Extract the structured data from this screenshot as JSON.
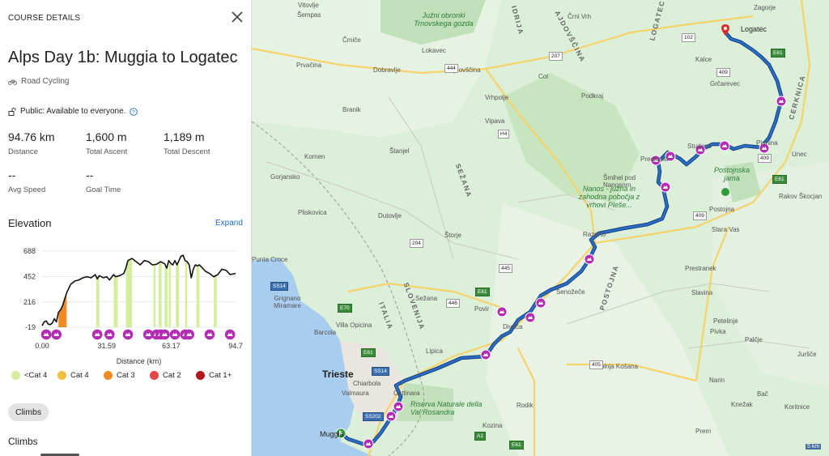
{
  "panel": {
    "header": "COURSE DETAILS",
    "title": "Alps Day 1b: Muggia to Logatec",
    "sport": "Road Cycling",
    "visibility": "Public: Available to everyone.",
    "stats": [
      {
        "value": "94.76 km",
        "label": "Distance"
      },
      {
        "value": "1,600 m",
        "label": "Total Ascent"
      },
      {
        "value": "1,189 m",
        "label": "Total Descent"
      },
      {
        "value": "--",
        "label": "Avg Speed"
      },
      {
        "value": "--",
        "label": "Goal Time"
      }
    ],
    "elevation_heading": "Elevation",
    "expand_label": "Expand",
    "climbs_chip": "Climbs",
    "climbs_heading": "Climbs"
  },
  "chart_data": {
    "type": "area",
    "title": "",
    "xlabel": "Distance (km)",
    "ylabel": "",
    "xlim": [
      0,
      94.7
    ],
    "ylim": [
      -19,
      688
    ],
    "y_ticks": [
      "688",
      "452",
      "216",
      "-19"
    ],
    "x_ticks": [
      "0.00",
      "31.59",
      "63.17",
      "94.7"
    ],
    "grid": true,
    "profile": {
      "x": [
        0,
        1,
        2,
        3,
        4,
        5,
        6,
        7,
        8,
        9,
        10,
        12,
        14,
        16,
        18,
        20,
        22,
        24,
        26,
        27,
        28,
        30,
        31.59,
        33,
        35,
        36,
        38,
        40,
        41,
        42,
        44,
        46,
        48,
        50,
        52,
        54,
        56,
        58,
        60,
        61,
        62,
        63.17,
        64,
        65,
        66,
        67,
        68,
        69,
        70,
        71,
        72,
        73,
        74,
        75,
        76,
        77,
        78,
        80,
        82,
        84,
        86,
        88,
        90,
        92,
        94.7
      ],
      "y": [
        -5,
        30,
        40,
        10,
        5,
        20,
        60,
        30,
        120,
        140,
        180,
        300,
        380,
        410,
        420,
        440,
        450,
        440,
        470,
        430,
        460,
        440,
        450,
        420,
        470,
        450,
        460,
        480,
        530,
        600,
        620,
        590,
        560,
        600,
        590,
        560,
        565,
        590,
        570,
        530,
        600,
        570,
        560,
        600,
        560,
        600,
        640,
        650,
        600,
        590,
        560,
        440,
        520,
        560,
        550,
        560,
        540,
        500,
        480,
        450,
        470,
        520,
        510,
        470,
        480
      ]
    },
    "climb_bands": [
      {
        "start": 8,
        "end": 12,
        "category": "Cat 3"
      },
      {
        "start": 26.5,
        "end": 28,
        "category": "<Cat 4"
      },
      {
        "start": 35,
        "end": 37,
        "category": "<Cat 4"
      },
      {
        "start": 41,
        "end": 44,
        "category": "<Cat 4"
      },
      {
        "start": 54.5,
        "end": 55.5,
        "category": "<Cat 4"
      },
      {
        "start": 57,
        "end": 58.5,
        "category": "<Cat 4"
      },
      {
        "start": 60,
        "end": 61.5,
        "category": "<Cat 4"
      },
      {
        "start": 62,
        "end": 63,
        "category": "<Cat 4"
      },
      {
        "start": 65.5,
        "end": 67,
        "category": "<Cat 4"
      },
      {
        "start": 70,
        "end": 71,
        "category": "<Cat 4"
      },
      {
        "start": 75.5,
        "end": 77,
        "category": "<Cat 4"
      },
      {
        "start": 84,
        "end": 85.5,
        "category": "<Cat 4"
      }
    ],
    "climb_markers_km": [
      2,
      7,
      27,
      33,
      42,
      52,
      56,
      58,
      60,
      65,
      70,
      72,
      82,
      92
    ],
    "legend": [
      {
        "name": "<Cat 4",
        "color": "#d4ee9e"
      },
      {
        "name": "Cat 4",
        "color": "#f2bf3f"
      },
      {
        "name": "Cat 3",
        "color": "#f08a24"
      },
      {
        "name": "Cat 2",
        "color": "#e64545"
      },
      {
        "name": "Cat 1+",
        "color": "#b01818"
      }
    ],
    "legend_position": "bottom"
  },
  "map": {
    "colors": {
      "route": "#2b6cc4",
      "route_casing": "#0f3a78",
      "climb_marker": "#b42bb4",
      "water": "#a9cdee",
      "land": "#dbeed8"
    },
    "labels": {
      "cities": [
        "Trieste",
        "Logatec",
        "Muggia"
      ],
      "towns": [
        "Vitovlje",
        "Šempas",
        "Čmiče",
        "Prvačina",
        "Dobravlje",
        "Ajdovščina",
        "Lokavec",
        "Col",
        "Vrhpolje",
        "Vipava",
        "Branik",
        "Štanjel",
        "Komen",
        "Gorjansko",
        "Pliskovica",
        "Dutovlje",
        "Štorje",
        "Sežana",
        "Povir",
        "Divača",
        "Lipica",
        "Villa Opicina",
        "Barcola",
        "Grignano Miramare",
        "Punta Croce",
        "Chiarbola",
        "Cattinara",
        "Valmaura",
        "Kozina",
        "Rodik",
        "Senožeče",
        "Razdrto",
        "Prestranek",
        "Slavina",
        "Petelinje",
        "Pivka",
        "Palčje",
        "Postojna",
        "Stara Vas",
        "Rakov Škocjan",
        "Unec",
        "Planina",
        "Studeno",
        "Predjama",
        "Šmihel pod Nanosom",
        "Nanos",
        "Kalce",
        "Grčarevec",
        "Podkraj",
        "Črni Vrh",
        "Dolnja Košana",
        "Narin",
        "Bač",
        "Knežak",
        "Koritnice",
        "Prem",
        "Juršče",
        "Zagorje"
      ],
      "parks": [
        "Južni obronki Trnovskega gozda",
        "Nanos - južna in zahodna pobočja z vrhovi Pleše...",
        "Riserva Naturale della Val Rosandra",
        "Postojnska jama"
      ],
      "regions": [
        "IDRIJA",
        "AJDOVŠČINA",
        "LOGATEC",
        "CERKNICA",
        "SEŽANA",
        "SLOVENIJA",
        "ITALIA",
        "POSTOJNA"
      ],
      "roads": [
        "102",
        "207",
        "444",
        "H4",
        "409",
        "E61",
        "204",
        "445",
        "446",
        "E70",
        "SS14",
        "SS202",
        "A1",
        "405"
      ]
    },
    "scale_label": "5 km"
  }
}
